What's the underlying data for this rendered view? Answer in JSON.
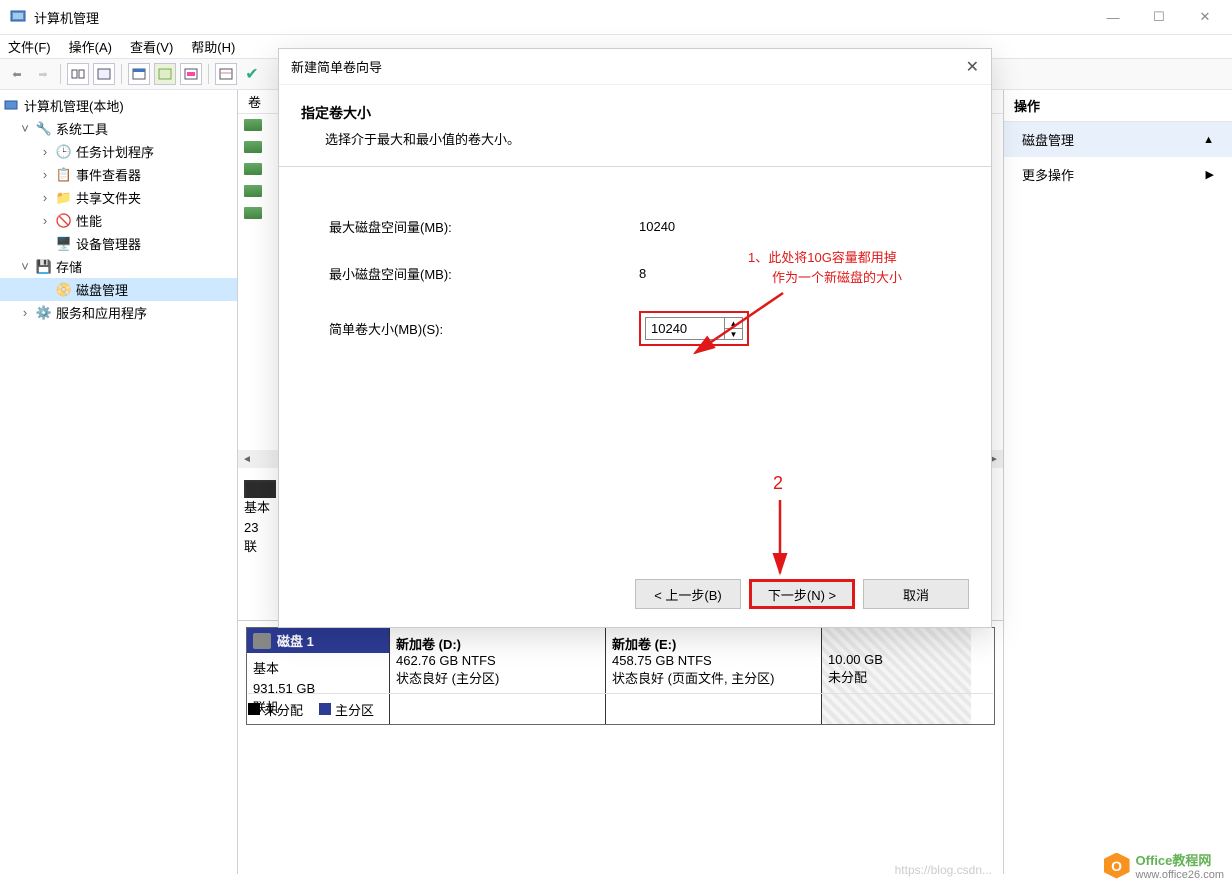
{
  "window": {
    "title": "计算机管理"
  },
  "menu": {
    "file": "文件(F)",
    "action": "操作(A)",
    "view": "查看(V)",
    "help": "帮助(H)"
  },
  "nav": {
    "root": "计算机管理(本地)",
    "systools": "系统工具",
    "scheduler": "任务计划程序",
    "eventviewer": "事件查看器",
    "sharedfolders": "共享文件夹",
    "performance": "性能",
    "devicemgr": "设备管理器",
    "storage": "存储",
    "diskmgmt": "磁盘管理",
    "services": "服务和应用程序"
  },
  "list_header": "卷",
  "side": {
    "header": "操作",
    "item1": "磁盘管理",
    "item2": "更多操作"
  },
  "disk_lower": {
    "basic_label": "基本",
    "basic_size": "23",
    "basic_status": "联"
  },
  "disk": {
    "title": "磁盘 1",
    "type": "基本",
    "size": "931.51 GB",
    "status": "联机",
    "vol_d": {
      "name": "新加卷  (D:)",
      "line2": "462.76 GB NTFS",
      "line3": "状态良好 (主分区)"
    },
    "vol_e": {
      "name": "新加卷  (E:)",
      "line2": "458.75 GB NTFS",
      "line3": "状态良好 (页面文件, 主分区)"
    },
    "vol_u": {
      "line1": "10.00 GB",
      "line2": "未分配"
    }
  },
  "legend": {
    "unalloc": "未分配",
    "primary": "主分区"
  },
  "wizard": {
    "title": "新建简单卷向导",
    "heading": "指定卷大小",
    "subheading": "选择介于最大和最小值的卷大小。",
    "max_label": "最大磁盘空间量(MB):",
    "max_value": "10240",
    "min_label": "最小磁盘空间量(MB):",
    "min_value": "8",
    "size_label": "简单卷大小(MB)(S):",
    "size_value": "10240",
    "back": "< 上一步(B)",
    "next": "下一步(N) >",
    "cancel": "取消"
  },
  "annot": {
    "line1": "1、此处将10G容量都用掉",
    "line2": "作为一个新磁盘的大小",
    "num2": "2"
  },
  "watermark": {
    "brand1": "Office",
    "brand2": "教程网",
    "url": "www.office26.com",
    "csdn": "https://blog.csdn..."
  }
}
